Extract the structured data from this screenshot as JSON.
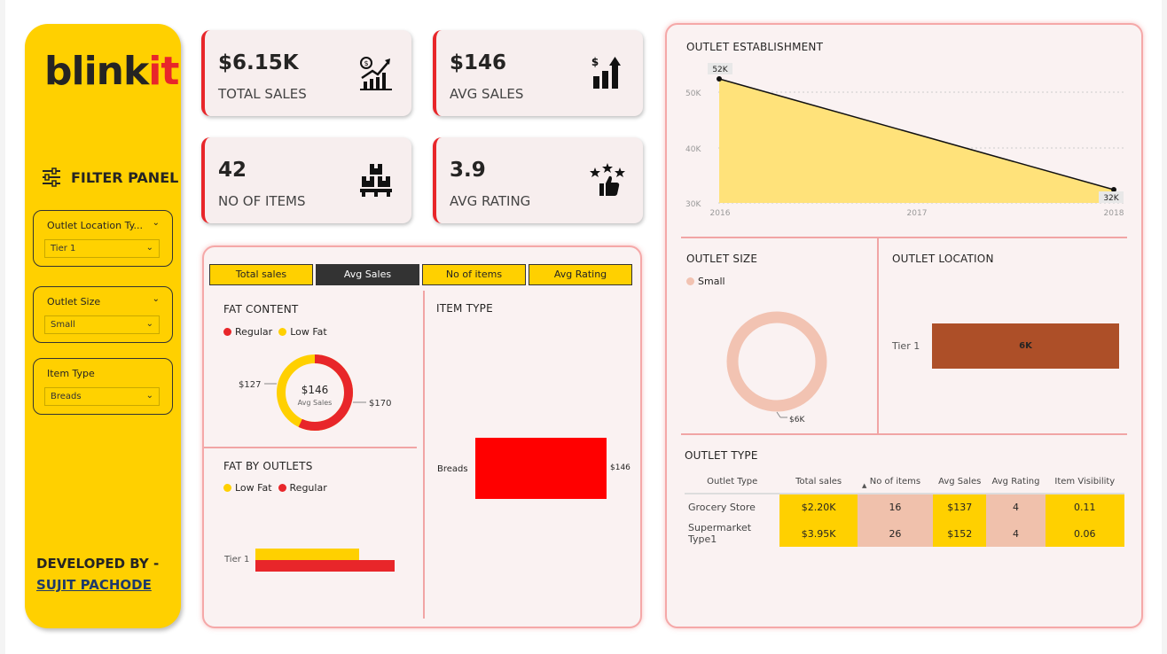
{
  "brand": {
    "part1": "blink",
    "part2": "it"
  },
  "filter_panel": {
    "title": "FILTER PANEL",
    "slicers": [
      {
        "label": "Outlet Location Ty...",
        "value": "Tier 1"
      },
      {
        "label": "Outlet Size",
        "value": "Small"
      },
      {
        "label": "Item Type",
        "value": "Breads"
      }
    ]
  },
  "developer": {
    "line1": "DEVELOPED BY -",
    "name": "SUJIT PACHODE"
  },
  "kpis": [
    {
      "value": "$6.15K",
      "caption": "TOTAL SALES",
      "icon": "sales-growth-icon"
    },
    {
      "value": "$146",
      "caption": "AVG SALES",
      "icon": "dollar-bars-icon"
    },
    {
      "value": "42",
      "caption": "NO OF ITEMS",
      "icon": "boxes-icon"
    },
    {
      "value": "3.9",
      "caption": "AVG RATING",
      "icon": "stars-thumbs-up-icon"
    }
  ],
  "tabs": [
    "Total sales",
    "Avg Sales",
    "No of items",
    "Avg Rating"
  ],
  "active_tab": "Avg Sales",
  "fat_content": {
    "title": "FAT CONTENT",
    "legend": [
      "Regular",
      "Low Fat"
    ],
    "center_value": "$146",
    "center_label": "Avg Sales",
    "label_left": "$127",
    "label_right": "$170"
  },
  "fat_by_outlets": {
    "title": "FAT BY OUTLETS",
    "legend": [
      "Low Fat",
      "Regular"
    ],
    "category": "Tier 1"
  },
  "item_type": {
    "title": "ITEM TYPE",
    "category": "Breads",
    "value_label": "$146"
  },
  "outlet_establishment": {
    "title": "OUTLET ESTABLISHMENT",
    "yticks": [
      "50K",
      "40K",
      "30K"
    ],
    "xticks": [
      "2016",
      "2017",
      "2018"
    ],
    "labels": [
      "52K",
      "32K"
    ]
  },
  "outlet_size": {
    "title": "OUTLET SIZE",
    "legend": "Small",
    "label": "$6K"
  },
  "outlet_location": {
    "title": "OUTLET LOCATION",
    "category": "Tier 1",
    "bar_label": "6K"
  },
  "outlet_type": {
    "title": "OUTLET TYPE",
    "columns": [
      "Outlet Type",
      "Total sales",
      "No of items",
      "Avg Sales",
      "Avg Rating",
      "Item Visibility"
    ],
    "rows": [
      [
        "Grocery Store",
        "$2.20K",
        "16",
        "$137",
        "4",
        "0.11"
      ],
      [
        "Supermarket Type1",
        "$3.95K",
        "26",
        "$152",
        "4",
        "0.06"
      ]
    ]
  },
  "colors": {
    "yellow": "#ffd000",
    "red": "#e8262a",
    "brown": "#ad4f28",
    "peach": "#f2c3b2"
  },
  "chart_data": [
    {
      "type": "pie",
      "title": "FAT CONTENT",
      "labels": [
        "Regular",
        "Low Fat"
      ],
      "values": [
        170,
        127
      ],
      "center": "$146 Avg Sales"
    },
    {
      "type": "bar",
      "title": "FAT BY OUTLETS",
      "categories": [
        "Tier 1"
      ],
      "series": [
        {
          "name": "Low Fat",
          "values": [
            127
          ]
        },
        {
          "name": "Regular",
          "values": [
            170
          ]
        }
      ]
    },
    {
      "type": "bar",
      "title": "ITEM TYPE",
      "categories": [
        "Breads"
      ],
      "values": [
        146
      ]
    },
    {
      "type": "area",
      "title": "OUTLET ESTABLISHMENT",
      "x": [
        2016,
        2018
      ],
      "values": [
        52000,
        32000
      ],
      "ylim": [
        30000,
        55000
      ]
    },
    {
      "type": "pie",
      "title": "OUTLET SIZE",
      "labels": [
        "Small"
      ],
      "values": [
        6000
      ]
    },
    {
      "type": "bar",
      "title": "OUTLET LOCATION",
      "categories": [
        "Tier 1"
      ],
      "values": [
        6000
      ]
    }
  ]
}
